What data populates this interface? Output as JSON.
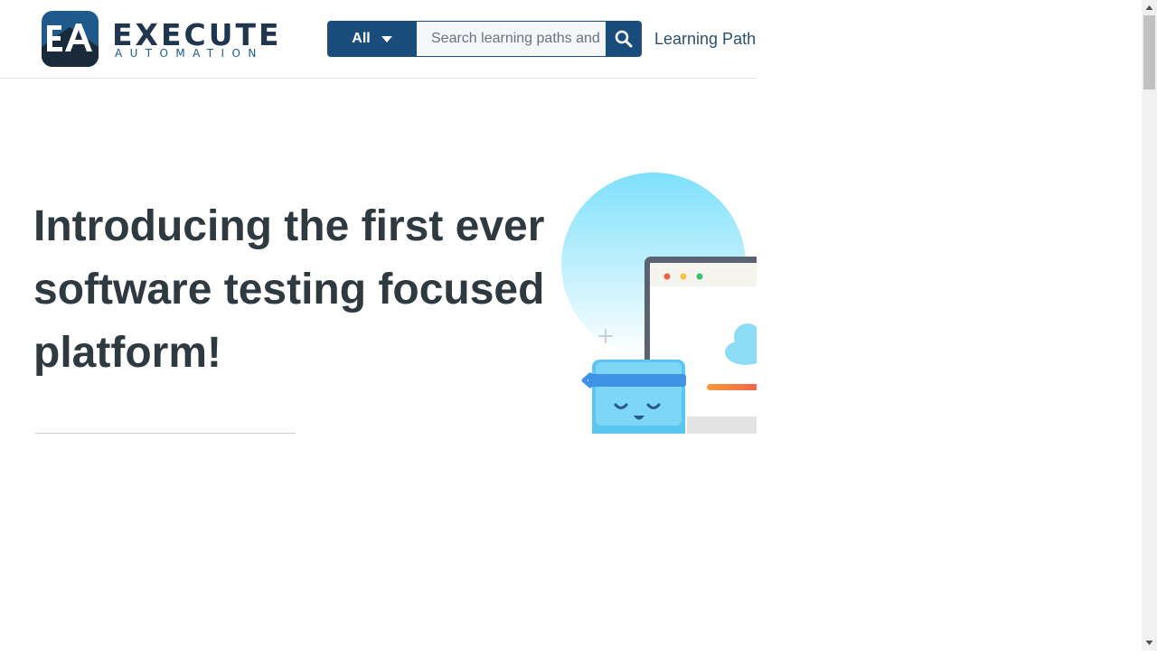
{
  "brand": {
    "name": "EXECUTE",
    "tagline": "AUTOMATION",
    "mark_letters": "EA"
  },
  "search": {
    "category": "All",
    "placeholder": "Search learning paths and"
  },
  "nav": {
    "learning_paths": "Learning Path"
  },
  "hero": {
    "title": "Introducing the first ever software testing focused platform!"
  },
  "colors": {
    "brand_navy": "#1a4d7c",
    "heading": "#2f3a40",
    "sky": "#8fe3fb"
  },
  "icons": [
    "search-icon",
    "chevron-down-icon",
    "scroll-up-arrow-icon",
    "scroll-down-arrow-icon"
  ]
}
